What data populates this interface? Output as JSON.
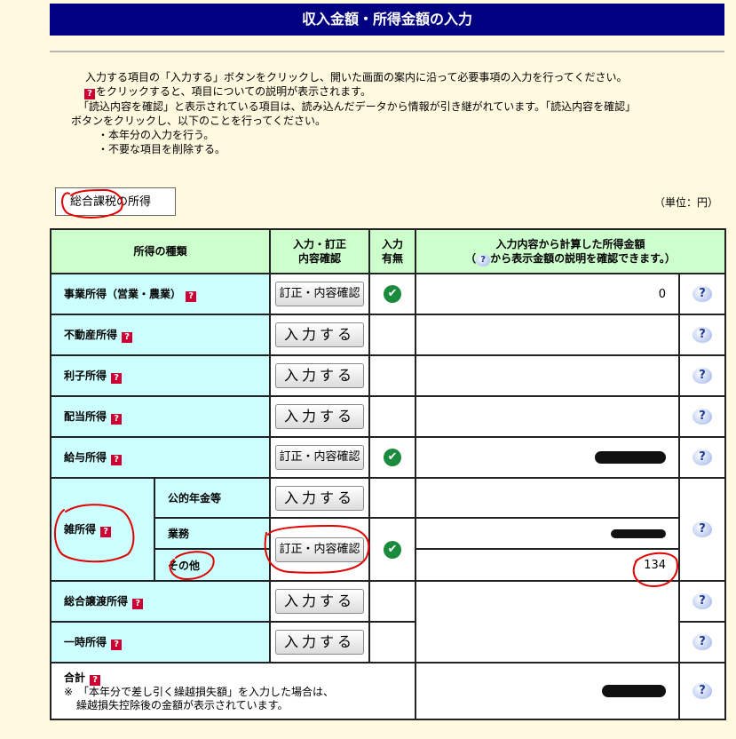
{
  "title": "収入金額・所得金額の入力",
  "intro": {
    "line1": "入力する項目の「入力する」ボタンをクリックし、開いた画面の案内に沿って必要事項の入力を行ってください。",
    "line2": "をクリックすると、項目についての説明が表示されます。",
    "line3": "「読込内容を確認」と表示されている項目は、読み込んだデータから情報が引き継がれています。「読込内容を確認」",
    "line4": "ボタンをクリックし、以下のことを行ってください。",
    "line5": "・本年分の入力を行う。",
    "line6": "・不要な項目を削除する。"
  },
  "tab_label": "総合課税の所得",
  "unit_label": "（単位：円）",
  "table": {
    "header": {
      "type": "所得の種類",
      "input1": "入力・訂正",
      "input2": "内容確認",
      "status1": "入力",
      "status2": "有無",
      "amount1": "入力内容から計算した所得金額",
      "amount2a": "（",
      "amount2b": "から表示金額の説明を確認できます。）"
    },
    "rows": {
      "business": {
        "label": "事業所得（営業・農業）",
        "button": "訂正・内容確認",
        "amount": "0"
      },
      "realestate": {
        "label": "不動産所得",
        "button": "入力する"
      },
      "interest": {
        "label": "利子所得",
        "button": "入力する"
      },
      "dividend": {
        "label": "配当所得",
        "button": "入力する"
      },
      "salary": {
        "label": "給与所得",
        "button": "訂正・内容確認"
      },
      "misc": {
        "label": "雑所得",
        "pension_label": "公的年金等",
        "pension_button": "入力する",
        "business_label": "業務",
        "other_label": "その他",
        "button": "訂正・内容確認",
        "other_amount": "134"
      },
      "transfer": {
        "label": "総合譲渡所得",
        "button": "入力する"
      },
      "temporary": {
        "label": "一時所得",
        "button": "入力する"
      },
      "total": {
        "label": "合計",
        "note1": "※　「本年分で差し引く繰越損失額」を入力した場合は、",
        "note2": "繰越損失控除後の金額が表示されています。"
      }
    },
    "help_char": "?",
    "qmark_char": "?",
    "check_char": "✔"
  },
  "colors": {
    "title_bg": "#000080",
    "header_bg": "#ccffcc",
    "label_bg": "#ccffff",
    "page_bg": "#fff9e0",
    "annotation": "#e00000"
  },
  "icons": [
    "help-icon",
    "question-icon",
    "check-icon"
  ]
}
